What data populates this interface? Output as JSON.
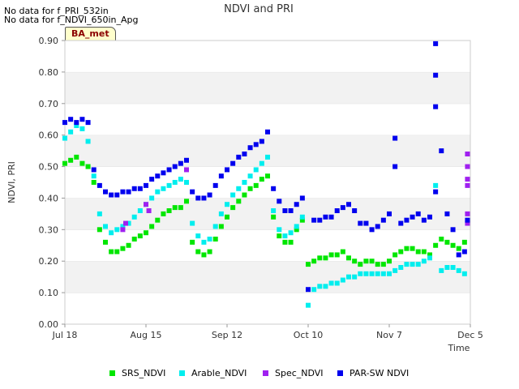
{
  "notes": [
    "No data for f_PRI_532in",
    "No data for f_NDVI_650in_Apg"
  ],
  "badge": "BA_met",
  "chart_data": {
    "type": "scatter",
    "title": "NDVI and PRI",
    "xlabel": "Time",
    "ylabel": "NDVI, PRI",
    "xlim": [
      "2024-07-18",
      "2024-12-05"
    ],
    "ylim": [
      0,
      0.9
    ],
    "x_ticks": [
      "2024-07-18",
      "2024-08-15",
      "2024-09-12",
      "2024-10-10",
      "2024-11-07",
      "2024-12-05"
    ],
    "x_tick_labels": [
      "Jul 18",
      "Aug 15",
      "Sep 12",
      "Oct 10",
      "Nov 7",
      "Dec 5"
    ],
    "y_ticks": [
      0,
      0.1,
      0.2,
      0.3,
      0.4,
      0.5,
      0.6,
      0.7,
      0.8,
      0.9
    ],
    "y_tick_labels": [
      "0.00",
      "0.10",
      "0.20",
      "0.30",
      "0.40",
      "0.50",
      "0.60",
      "0.70",
      "0.80",
      "0.90"
    ],
    "grid": "horizontal bands",
    "legend": "bottom",
    "series": [
      {
        "name": "SRS_NDVI",
        "color": "#00e600",
        "points": [
          [
            "2024-07-18",
            0.51
          ],
          [
            "2024-07-20",
            0.52
          ],
          [
            "2024-07-22",
            0.53
          ],
          [
            "2024-07-24",
            0.51
          ],
          [
            "2024-07-26",
            0.5
          ],
          [
            "2024-07-28",
            0.45
          ],
          [
            "2024-07-30",
            0.3
          ],
          [
            "2024-08-01",
            0.26
          ],
          [
            "2024-08-03",
            0.23
          ],
          [
            "2024-08-05",
            0.23
          ],
          [
            "2024-08-07",
            0.24
          ],
          [
            "2024-08-09",
            0.25
          ],
          [
            "2024-08-11",
            0.27
          ],
          [
            "2024-08-13",
            0.28
          ],
          [
            "2024-08-15",
            0.29
          ],
          [
            "2024-08-17",
            0.31
          ],
          [
            "2024-08-19",
            0.33
          ],
          [
            "2024-08-21",
            0.35
          ],
          [
            "2024-08-23",
            0.36
          ],
          [
            "2024-08-25",
            0.37
          ],
          [
            "2024-08-27",
            0.37
          ],
          [
            "2024-08-29",
            0.39
          ],
          [
            "2024-08-31",
            0.26
          ],
          [
            "2024-09-02",
            0.23
          ],
          [
            "2024-09-04",
            0.22
          ],
          [
            "2024-09-06",
            0.23
          ],
          [
            "2024-09-08",
            0.27
          ],
          [
            "2024-09-10",
            0.31
          ],
          [
            "2024-09-12",
            0.34
          ],
          [
            "2024-09-14",
            0.37
          ],
          [
            "2024-09-16",
            0.39
          ],
          [
            "2024-09-18",
            0.41
          ],
          [
            "2024-09-20",
            0.43
          ],
          [
            "2024-09-22",
            0.44
          ],
          [
            "2024-09-24",
            0.46
          ],
          [
            "2024-09-26",
            0.47
          ],
          [
            "2024-09-28",
            0.34
          ],
          [
            "2024-09-30",
            0.28
          ],
          [
            "2024-10-02",
            0.26
          ],
          [
            "2024-10-04",
            0.26
          ],
          [
            "2024-10-06",
            0.3
          ],
          [
            "2024-10-08",
            0.33
          ],
          [
            "2024-10-10",
            0.19
          ],
          [
            "2024-10-12",
            0.2
          ],
          [
            "2024-10-14",
            0.21
          ],
          [
            "2024-10-16",
            0.21
          ],
          [
            "2024-10-18",
            0.22
          ],
          [
            "2024-10-20",
            0.22
          ],
          [
            "2024-10-22",
            0.23
          ],
          [
            "2024-10-24",
            0.21
          ],
          [
            "2024-10-26",
            0.2
          ],
          [
            "2024-10-28",
            0.19
          ],
          [
            "2024-10-30",
            0.2
          ],
          [
            "2024-11-01",
            0.2
          ],
          [
            "2024-11-03",
            0.19
          ],
          [
            "2024-11-05",
            0.19
          ],
          [
            "2024-11-07",
            0.2
          ],
          [
            "2024-11-09",
            0.22
          ],
          [
            "2024-11-11",
            0.23
          ],
          [
            "2024-11-13",
            0.24
          ],
          [
            "2024-11-15",
            0.24
          ],
          [
            "2024-11-17",
            0.23
          ],
          [
            "2024-11-19",
            0.23
          ],
          [
            "2024-11-21",
            0.22
          ],
          [
            "2024-11-23",
            0.25
          ],
          [
            "2024-11-25",
            0.27
          ],
          [
            "2024-11-27",
            0.26
          ],
          [
            "2024-11-29",
            0.25
          ],
          [
            "2024-12-01",
            0.24
          ],
          [
            "2024-12-03",
            0.26
          ]
        ]
      },
      {
        "name": "Arable_NDVI",
        "color": "#00eeee",
        "points": [
          [
            "2024-07-18",
            0.59
          ],
          [
            "2024-07-20",
            0.61
          ],
          [
            "2024-07-22",
            0.63
          ],
          [
            "2024-07-24",
            0.62
          ],
          [
            "2024-07-26",
            0.58
          ],
          [
            "2024-07-28",
            0.47
          ],
          [
            "2024-07-30",
            0.35
          ],
          [
            "2024-08-01",
            0.31
          ],
          [
            "2024-08-03",
            0.29
          ],
          [
            "2024-08-05",
            0.3
          ],
          [
            "2024-08-07",
            0.31
          ],
          [
            "2024-08-09",
            0.32
          ],
          [
            "2024-08-11",
            0.34
          ],
          [
            "2024-08-13",
            0.36
          ],
          [
            "2024-08-15",
            0.38
          ],
          [
            "2024-08-17",
            0.4
          ],
          [
            "2024-08-19",
            0.42
          ],
          [
            "2024-08-21",
            0.43
          ],
          [
            "2024-08-23",
            0.44
          ],
          [
            "2024-08-25",
            0.45
          ],
          [
            "2024-08-27",
            0.46
          ],
          [
            "2024-08-29",
            0.45
          ],
          [
            "2024-08-31",
            0.32
          ],
          [
            "2024-09-02",
            0.28
          ],
          [
            "2024-09-04",
            0.26
          ],
          [
            "2024-09-06",
            0.27
          ],
          [
            "2024-09-08",
            0.31
          ],
          [
            "2024-09-10",
            0.35
          ],
          [
            "2024-09-12",
            0.38
          ],
          [
            "2024-09-14",
            0.41
          ],
          [
            "2024-09-16",
            0.43
          ],
          [
            "2024-09-18",
            0.45
          ],
          [
            "2024-09-20",
            0.47
          ],
          [
            "2024-09-22",
            0.49
          ],
          [
            "2024-09-24",
            0.51
          ],
          [
            "2024-09-26",
            0.53
          ],
          [
            "2024-09-28",
            0.36
          ],
          [
            "2024-09-30",
            0.3
          ],
          [
            "2024-10-02",
            0.28
          ],
          [
            "2024-10-04",
            0.29
          ],
          [
            "2024-10-06",
            0.31
          ],
          [
            "2024-10-08",
            0.34
          ],
          [
            "2024-10-10",
            0.06
          ],
          [
            "2024-10-12",
            0.11
          ],
          [
            "2024-10-14",
            0.12
          ],
          [
            "2024-10-16",
            0.12
          ],
          [
            "2024-10-18",
            0.13
          ],
          [
            "2024-10-20",
            0.13
          ],
          [
            "2024-10-22",
            0.14
          ],
          [
            "2024-10-24",
            0.15
          ],
          [
            "2024-10-26",
            0.15
          ],
          [
            "2024-10-28",
            0.16
          ],
          [
            "2024-10-30",
            0.16
          ],
          [
            "2024-11-01",
            0.16
          ],
          [
            "2024-11-03",
            0.16
          ],
          [
            "2024-11-05",
            0.16
          ],
          [
            "2024-11-07",
            0.16
          ],
          [
            "2024-11-09",
            0.17
          ],
          [
            "2024-11-11",
            0.18
          ],
          [
            "2024-11-13",
            0.19
          ],
          [
            "2024-11-15",
            0.19
          ],
          [
            "2024-11-17",
            0.19
          ],
          [
            "2024-11-19",
            0.2
          ],
          [
            "2024-11-21",
            0.21
          ],
          [
            "2024-11-23",
            0.44
          ],
          [
            "2024-11-25",
            0.17
          ],
          [
            "2024-11-27",
            0.18
          ],
          [
            "2024-11-29",
            0.18
          ],
          [
            "2024-12-01",
            0.17
          ],
          [
            "2024-12-03",
            0.16
          ]
        ]
      },
      {
        "name": "Spec_NDVI",
        "color": "#a020f0",
        "points": [
          [
            "2024-08-07",
            0.3
          ],
          [
            "2024-08-08",
            0.32
          ],
          [
            "2024-08-15",
            0.38
          ],
          [
            "2024-08-16",
            0.36
          ],
          [
            "2024-08-29",
            0.49
          ],
          [
            "2024-12-04",
            0.54
          ],
          [
            "2024-12-04",
            0.5
          ],
          [
            "2024-12-04",
            0.46
          ],
          [
            "2024-12-04",
            0.44
          ],
          [
            "2024-12-04",
            0.35
          ],
          [
            "2024-12-04",
            0.32
          ]
        ]
      },
      {
        "name": "PAR-SW NDVI",
        "color": "#0000ee",
        "points": [
          [
            "2024-07-18",
            0.64
          ],
          [
            "2024-07-20",
            0.65
          ],
          [
            "2024-07-22",
            0.64
          ],
          [
            "2024-07-24",
            0.65
          ],
          [
            "2024-07-26",
            0.64
          ],
          [
            "2024-07-28",
            0.49
          ],
          [
            "2024-07-30",
            0.44
          ],
          [
            "2024-08-01",
            0.42
          ],
          [
            "2024-08-03",
            0.41
          ],
          [
            "2024-08-05",
            0.41
          ],
          [
            "2024-08-07",
            0.42
          ],
          [
            "2024-08-09",
            0.42
          ],
          [
            "2024-08-11",
            0.43
          ],
          [
            "2024-08-13",
            0.43
          ],
          [
            "2024-08-15",
            0.44
          ],
          [
            "2024-08-17",
            0.46
          ],
          [
            "2024-08-19",
            0.47
          ],
          [
            "2024-08-21",
            0.48
          ],
          [
            "2024-08-23",
            0.49
          ],
          [
            "2024-08-25",
            0.5
          ],
          [
            "2024-08-27",
            0.51
          ],
          [
            "2024-08-29",
            0.52
          ],
          [
            "2024-08-31",
            0.42
          ],
          [
            "2024-09-02",
            0.4
          ],
          [
            "2024-09-04",
            0.4
          ],
          [
            "2024-09-06",
            0.41
          ],
          [
            "2024-09-08",
            0.44
          ],
          [
            "2024-09-10",
            0.47
          ],
          [
            "2024-09-12",
            0.49
          ],
          [
            "2024-09-14",
            0.51
          ],
          [
            "2024-09-16",
            0.53
          ],
          [
            "2024-09-18",
            0.54
          ],
          [
            "2024-09-20",
            0.56
          ],
          [
            "2024-09-22",
            0.57
          ],
          [
            "2024-09-24",
            0.58
          ],
          [
            "2024-09-26",
            0.61
          ],
          [
            "2024-09-28",
            0.43
          ],
          [
            "2024-09-30",
            0.39
          ],
          [
            "2024-10-02",
            0.36
          ],
          [
            "2024-10-04",
            0.36
          ],
          [
            "2024-10-06",
            0.38
          ],
          [
            "2024-10-08",
            0.4
          ],
          [
            "2024-10-10",
            0.11
          ],
          [
            "2024-10-12",
            0.33
          ],
          [
            "2024-10-14",
            0.33
          ],
          [
            "2024-10-16",
            0.34
          ],
          [
            "2024-10-18",
            0.34
          ],
          [
            "2024-10-20",
            0.36
          ],
          [
            "2024-10-22",
            0.37
          ],
          [
            "2024-10-24",
            0.38
          ],
          [
            "2024-10-26",
            0.36
          ],
          [
            "2024-10-28",
            0.32
          ],
          [
            "2024-10-30",
            0.32
          ],
          [
            "2024-11-01",
            0.3
          ],
          [
            "2024-11-03",
            0.31
          ],
          [
            "2024-11-05",
            0.33
          ],
          [
            "2024-11-07",
            0.35
          ],
          [
            "2024-11-09",
            0.5
          ],
          [
            "2024-11-09",
            0.59
          ],
          [
            "2024-11-11",
            0.32
          ],
          [
            "2024-11-13",
            0.33
          ],
          [
            "2024-11-15",
            0.34
          ],
          [
            "2024-11-17",
            0.35
          ],
          [
            "2024-11-19",
            0.33
          ],
          [
            "2024-11-21",
            0.34
          ],
          [
            "2024-11-23",
            0.89
          ],
          [
            "2024-11-23",
            0.79
          ],
          [
            "2024-11-23",
            0.69
          ],
          [
            "2024-11-23",
            0.42
          ],
          [
            "2024-11-25",
            0.55
          ],
          [
            "2024-11-27",
            0.35
          ],
          [
            "2024-11-29",
            0.3
          ],
          [
            "2024-12-01",
            0.22
          ],
          [
            "2024-12-03",
            0.23
          ],
          [
            "2024-12-04",
            0.33
          ]
        ]
      }
    ]
  }
}
